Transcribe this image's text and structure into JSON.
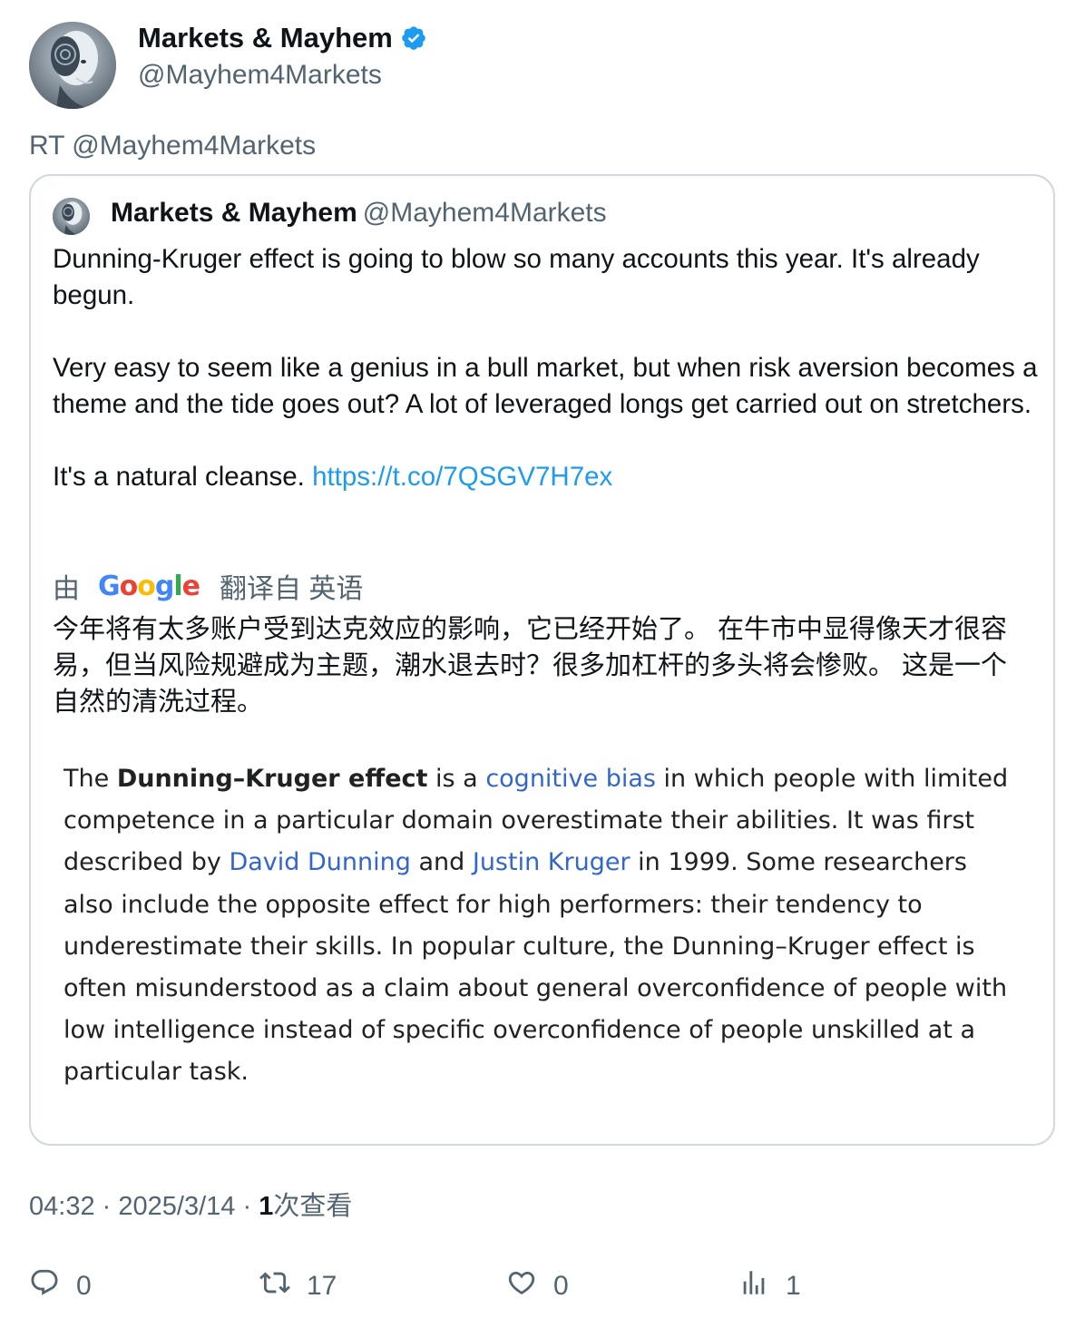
{
  "author": {
    "display_name": "Markets & Mayhem",
    "handle": "@Mayhem4Markets",
    "avatar_icon": "robot-head-avatar",
    "verified": true
  },
  "retweet_line": "RT @Mayhem4Markets",
  "quoted": {
    "display_name": "Markets & Mayhem",
    "handle": "@Mayhem4Markets",
    "paragraphs": [
      "Dunning-Kruger effect is going to blow so many accounts this year. It's already begun.",
      "Very easy to seem like a genius in a bull market, but when risk aversion becomes a theme and the tide goes out? A lot of leveraged longs get carried out on stretchers."
    ],
    "last_paragraph_text": "It's a natural cleanse.",
    "link": "https://t.co/7QSGV7H7ex",
    "translation": {
      "by_label": "由",
      "provider": "Google",
      "from_label": "翻译自 英语",
      "text": "今年将有太多账户受到达克效应的影响，它已经开始了。 在牛市中显得像天才很容易，但当风险规避成为主题，潮水退去时？很多加杠杆的多头将会惨败。 这是一个自然的清洗过程。"
    },
    "excerpt": {
      "the": "The",
      "term": "Dunning–Kruger effect",
      "is_a": "is a",
      "link1": "cognitive bias",
      "part1": "in which people with limited competence in a particular domain overestimate their abilities. It was first described by",
      "link2": "David Dunning",
      "and": "and",
      "link3": "Justin Kruger",
      "part2": "in 1999. Some researchers also include the opposite effect for high performers: their tendency to underestimate their skills. In popular culture, the Dunning–Kruger effect is often misunderstood as a claim about general overconfidence of people with low intelligence instead of specific overconfidence of people unskilled at a particular task."
    }
  },
  "meta": {
    "time": "04:32",
    "date": "2025/3/14",
    "separator": "·",
    "views_count": "1",
    "views_label": "次查看"
  },
  "actions": {
    "reply": {
      "icon": "reply-icon",
      "count": "0"
    },
    "retweet": {
      "icon": "retweet-icon",
      "count": "17"
    },
    "like": {
      "icon": "heart-icon",
      "count": "0"
    },
    "views": {
      "icon": "analytics-icon",
      "count": "1"
    }
  },
  "colors": {
    "link_blue": "#1d9bf0",
    "muted_gray": "#536471",
    "wiki_link": "#3366cc",
    "verified_blue": "#1d9bf0"
  }
}
